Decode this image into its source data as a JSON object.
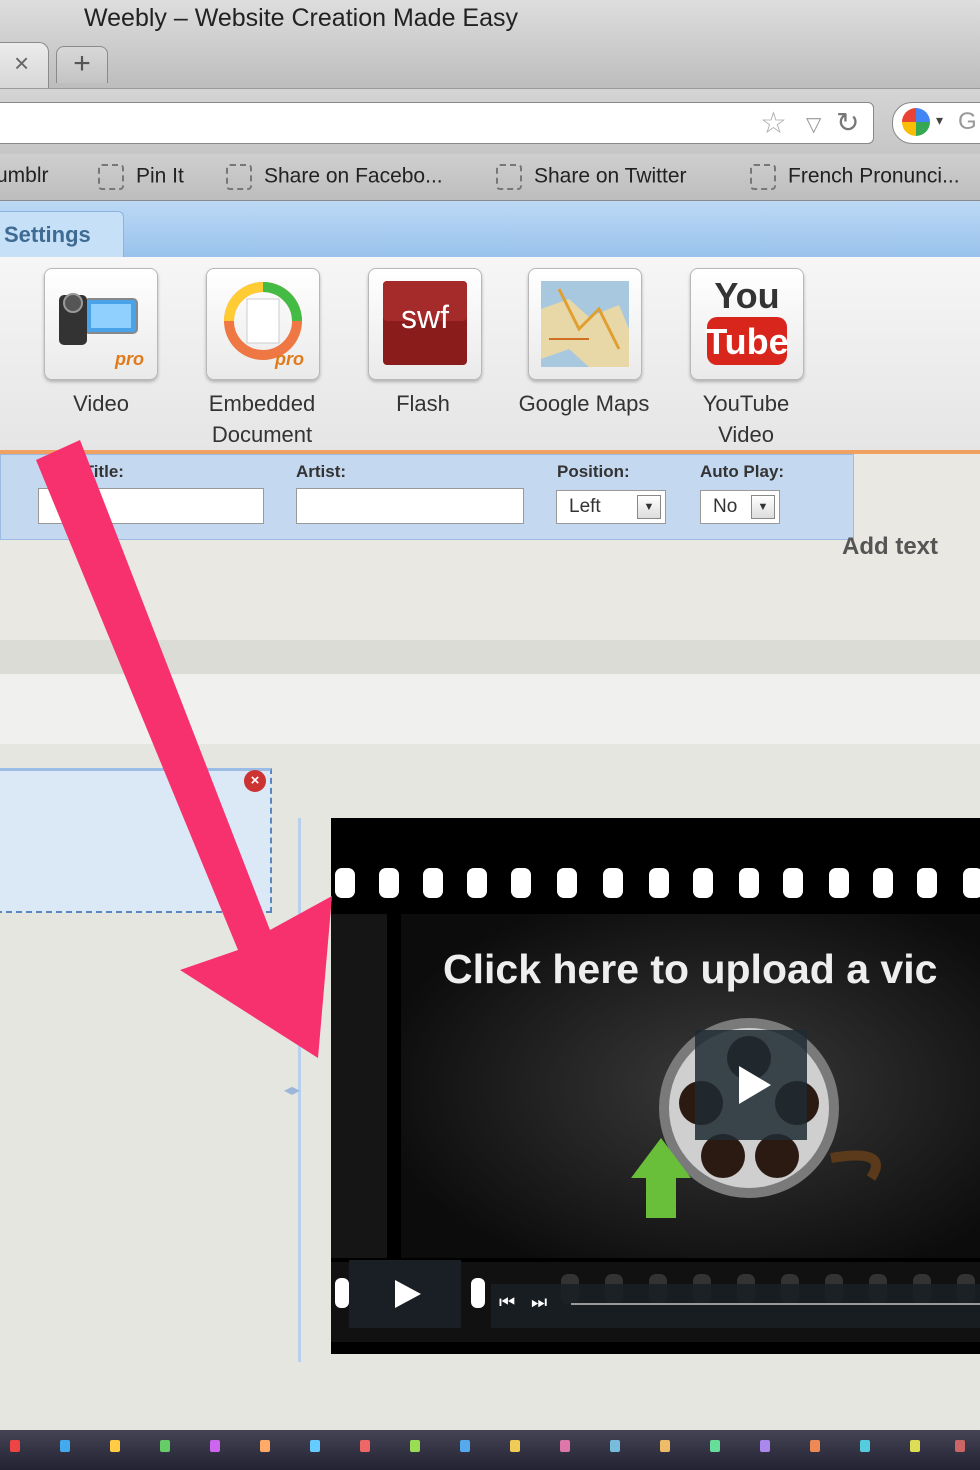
{
  "window": {
    "title": "Weebly – Website Creation Made Easy",
    "tab_close": "×",
    "new_tab": "+"
  },
  "navbar": {
    "search_letter": "G"
  },
  "bookmarks": [
    "umblr",
    "Pin It",
    "Share on Facebo...",
    "Share on Twitter",
    "French Pronunci..."
  ],
  "editor": {
    "settings_tab": "Settings",
    "add_text": "Add text"
  },
  "elements": [
    {
      "label": "Video",
      "icon": "video-camera-icon"
    },
    {
      "label": "Embedded Document",
      "icon": "embedded-document-icon"
    },
    {
      "label": "Flash",
      "icon": "swf-icon",
      "badge": "swf"
    },
    {
      "label": "Google Maps",
      "icon": "map-icon"
    },
    {
      "label": "YouTube Video",
      "icon": "youtube-icon",
      "line1": "You",
      "line2": "Tube"
    }
  ],
  "properties": {
    "track_title_label": "ck Title:",
    "artist_label": "Artist:",
    "position_label": "Position:",
    "position_value": "Left",
    "autoplay_label": "Auto Play:",
    "autoplay_value": "No"
  },
  "video": {
    "upload_text": "Click here to upload a vic"
  },
  "colors": {
    "accent_orange": "#f0a060",
    "arrow_pink": "#f7306e",
    "tab_blue": "#99c2ec"
  }
}
